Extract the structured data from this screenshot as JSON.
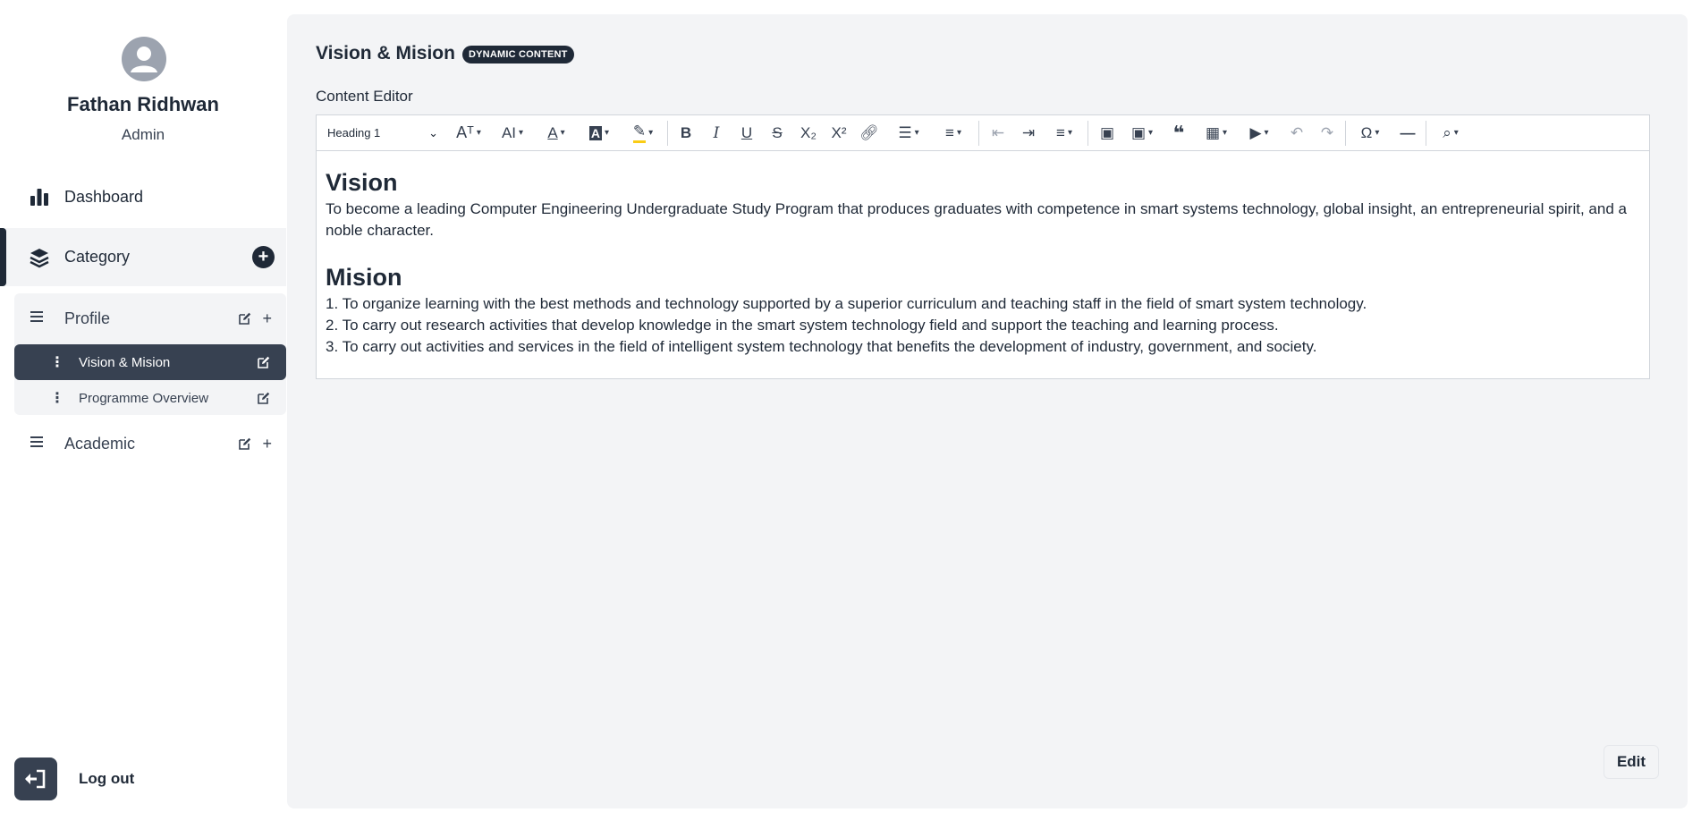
{
  "user": {
    "name": "Fathan Ridhwan",
    "role": "Admin"
  },
  "sidebar": {
    "dashboard_label": "Dashboard",
    "category_label": "Category",
    "add_category_label": "+",
    "groups": [
      {
        "label": "Profile",
        "add_label": "+",
        "pages": [
          {
            "label": "Vision & Mision",
            "active": true
          },
          {
            "label": "Programme Overview",
            "active": false
          }
        ]
      },
      {
        "label": "Academic",
        "add_label": "+"
      }
    ],
    "logout_label": "Log out"
  },
  "main": {
    "title": "Vision & Mision",
    "badge": "DYNAMIC CONTENT",
    "editor_label": "Content Editor",
    "toolbar": {
      "heading_select": "Heading 1"
    },
    "content": {
      "vision_heading": "Vision",
      "vision_text": "To become a leading Computer Engineering Undergraduate Study Program that produces graduates with competence in smart systems technology, global insight, an entrepreneurial spirit, and a noble character.",
      "mission_heading": "Mision",
      "mission_items": [
        "1. To organize learning with the best methods and technology supported by a superior curriculum and teaching staff in the field of smart system technology.",
        "2. To carry out research activities that develop knowledge in the smart system technology field and support the teaching and learning process.",
        "3. To carry out activities and services in the field of intelligent system technology that benefits the development of industry, government, and society."
      ]
    },
    "edit_button": "Edit"
  },
  "colors": {
    "dark": "#1f2937",
    "active_bg": "#374151",
    "panel_bg": "#f3f4f6"
  },
  "icons": [
    "user-avatar-icon",
    "bar-chart-icon",
    "layers-icon",
    "plus-circle-icon",
    "menu-icon",
    "edit-icon",
    "plus-icon",
    "kebab-icon",
    "logout-icon"
  ]
}
